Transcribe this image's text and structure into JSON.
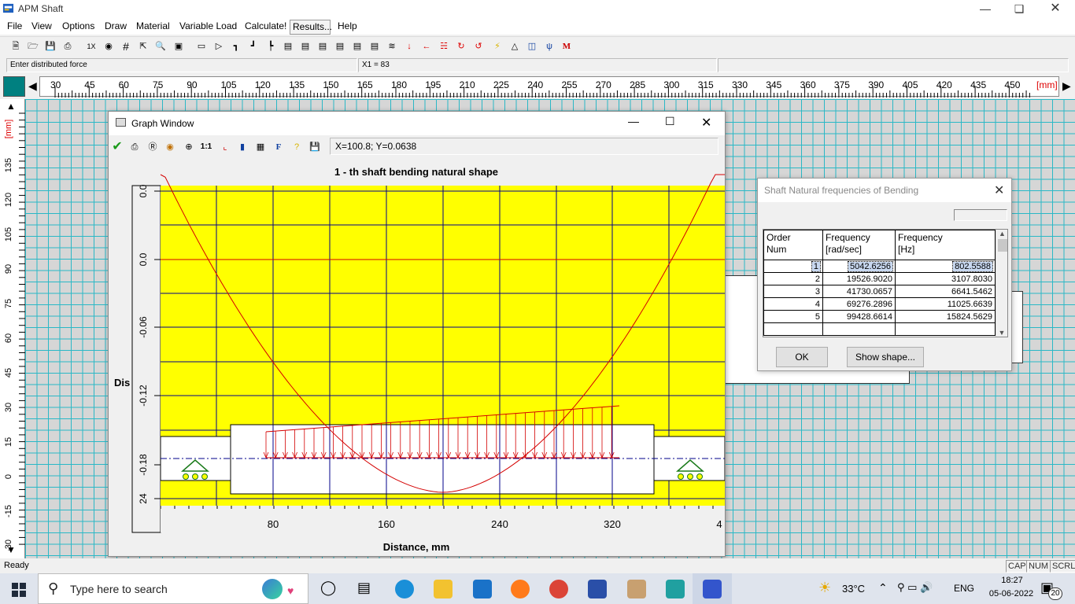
{
  "app": {
    "title": "APM Shaft"
  },
  "menu": [
    "File",
    "View",
    "Options",
    "Draw",
    "Material",
    "Variable Load",
    "Calculate!",
    "Results...",
    "Help"
  ],
  "toolbar": {
    "zoom_1x": "1X",
    "grid_icon": "#"
  },
  "status_top": {
    "prompt": "Enter distributed force",
    "coord": "X1 = 83"
  },
  "ruler": {
    "labels": [
      "30",
      "45",
      "60",
      "75",
      "90",
      "105",
      "120",
      "135",
      "150",
      "165",
      "180",
      "195",
      "210",
      "225",
      "240",
      "255",
      "270",
      "285",
      "300",
      "315",
      "330",
      "345",
      "360",
      "375",
      "390",
      "405",
      "420",
      "435",
      "450"
    ],
    "unit": "[mm]",
    "vlabels": [
      "[mm]",
      "135",
      "120",
      "105",
      "90",
      "75",
      "60",
      "45",
      "30",
      "15",
      "0",
      "-15",
      "-30"
    ]
  },
  "graph_window": {
    "title": "Graph Window",
    "coord_readout": "X=100.8; Y=0.0638",
    "tb_one_to_one": "1:1",
    "tb_font": "F",
    "plot_title": "1 - th shaft bending natural shape",
    "y_tick_labels": [
      "0.0",
      "0.0",
      "-0.06",
      "-0.12",
      "-0.18",
      "24"
    ],
    "y_axis_fragment": "Dis",
    "x_tick_labels": [
      "80",
      "160",
      "240",
      "320",
      "4"
    ],
    "x_axis_label": "Distance, mm",
    "colors": {
      "background": "#ffff00",
      "curve": "#d40000",
      "grid": "#00008b"
    }
  },
  "freq_dialog": {
    "title": "Shaft Natural frequencies of Bending",
    "headers": [
      "Order\nNum",
      "Frequency\n[rad/sec]",
      "Frequency\n[Hz]"
    ],
    "rows": [
      {
        "order": "1",
        "rad": "5042.6256",
        "hz": "802.5588"
      },
      {
        "order": "2",
        "rad": "19526.9020",
        "hz": "3107.8030"
      },
      {
        "order": "3",
        "rad": "41730.0657",
        "hz": "6641.5462"
      },
      {
        "order": "4",
        "rad": "69276.2896",
        "hz": "11025.6639"
      },
      {
        "order": "5",
        "rad": "99428.6614",
        "hz": "15824.5629"
      }
    ],
    "ok_label": "OK",
    "show_shape_label": "Show shape..."
  },
  "statusbar": {
    "text": "Ready",
    "indicators": [
      "CAP",
      "NUM",
      "SCRL"
    ]
  },
  "taskbar": {
    "search_placeholder": "Type here to search",
    "weather": "33°C",
    "language": "ENG",
    "time": "18:27",
    "date": "05-06-2022",
    "notification_count": "20"
  }
}
